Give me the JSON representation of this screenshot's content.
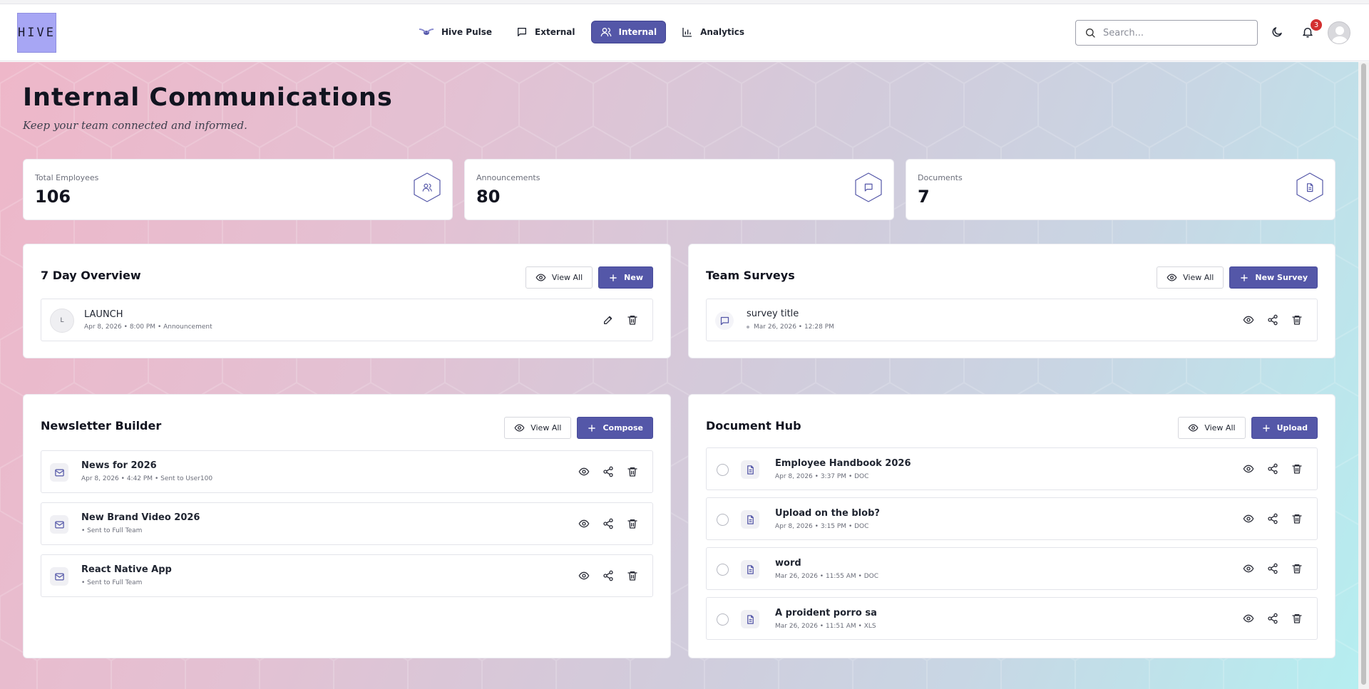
{
  "app": {
    "logo": "HIVE"
  },
  "nav": [
    {
      "label": "Hive Pulse",
      "icon": "bee-icon",
      "active": false
    },
    {
      "label": "External",
      "icon": "message-square-icon",
      "active": false
    },
    {
      "label": "Internal",
      "icon": "users-icon",
      "active": true
    },
    {
      "label": "Analytics",
      "icon": "bar-chart-icon",
      "active": false
    }
  ],
  "search": {
    "placeholder": "Search..."
  },
  "notifications": {
    "count": "3"
  },
  "page": {
    "title": "Internal Communications",
    "subtitle": "Keep your team connected and informed."
  },
  "stats": [
    {
      "label": "Total Employees",
      "value": "106",
      "icon": "users-icon"
    },
    {
      "label": "Announcements",
      "value": "80",
      "icon": "message-square-icon"
    },
    {
      "label": "Documents",
      "value": "7",
      "icon": "file-text-icon"
    }
  ],
  "overview": {
    "title": "7 Day Overview",
    "view_all": "View All",
    "new_label": "New",
    "items": [
      {
        "initial": "L",
        "title": "LAUNCH",
        "meta": "Apr 8, 2026 • 8:00 PM • Announcement"
      }
    ]
  },
  "surveys": {
    "title": "Team Surveys",
    "view_all": "View All",
    "new_label": "New Survey",
    "items": [
      {
        "title": "survey title",
        "meta": "Mar 26, 2026 • 12:28 PM"
      }
    ]
  },
  "newsletter": {
    "title": "Newsletter Builder",
    "view_all": "View All",
    "compose_label": "Compose",
    "items": [
      {
        "title": "News for 2026",
        "meta": "Apr 8, 2026 • 4:42 PM • Sent to User100"
      },
      {
        "title": "New Brand Video 2026",
        "meta": "• Sent to Full Team"
      },
      {
        "title": "React Native App",
        "meta": "• Sent to Full Team"
      }
    ]
  },
  "documents": {
    "title": "Document Hub",
    "view_all": "View All",
    "upload_label": "Upload",
    "items": [
      {
        "title": "Employee Handbook 2026",
        "meta": "Apr 8, 2026 • 3:37 PM • DOC"
      },
      {
        "title": "Upload on the blob?",
        "meta": "Apr 8, 2026 • 3:15 PM • DOC"
      },
      {
        "title": "word",
        "meta": "Mar 26, 2026 • 11:55 AM • DOC"
      },
      {
        "title": "A proident porro sa",
        "meta": "Mar 26, 2026 • 11:51 AM • XLS"
      }
    ]
  },
  "colors": {
    "accent": "#5457a8",
    "logo_bg": "#a7a6f4",
    "badge": "#d32f2f"
  }
}
